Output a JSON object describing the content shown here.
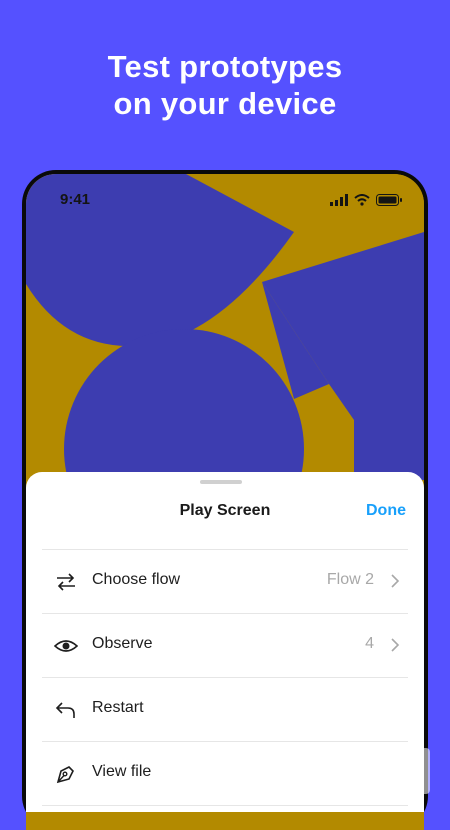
{
  "promo": {
    "headline_line1": "Test prototypes",
    "headline_line2": "on your device"
  },
  "phone": {
    "status_time": "9:41",
    "status_icons": [
      "signal-icon",
      "wifi-icon",
      "battery-icon"
    ]
  },
  "sheet": {
    "title": "Play Screen",
    "done_label": "Done",
    "rows": [
      {
        "label": "Choose flow",
        "value": "Flow 2",
        "icon": "shuffle-icon",
        "has_chevron": true
      },
      {
        "label": "Observe",
        "value": "4",
        "icon": "eye-icon",
        "has_chevron": true
      },
      {
        "label": "Restart",
        "value": "",
        "icon": "undo-icon",
        "has_chevron": false
      },
      {
        "label": "View file",
        "value": "",
        "icon": "pen-tool-icon",
        "has_chevron": false
      }
    ]
  },
  "colors": {
    "background": "#5551ff",
    "art_gold": "#b38a00",
    "art_blue": "#3d3db0",
    "accent": "#18a0fb"
  }
}
